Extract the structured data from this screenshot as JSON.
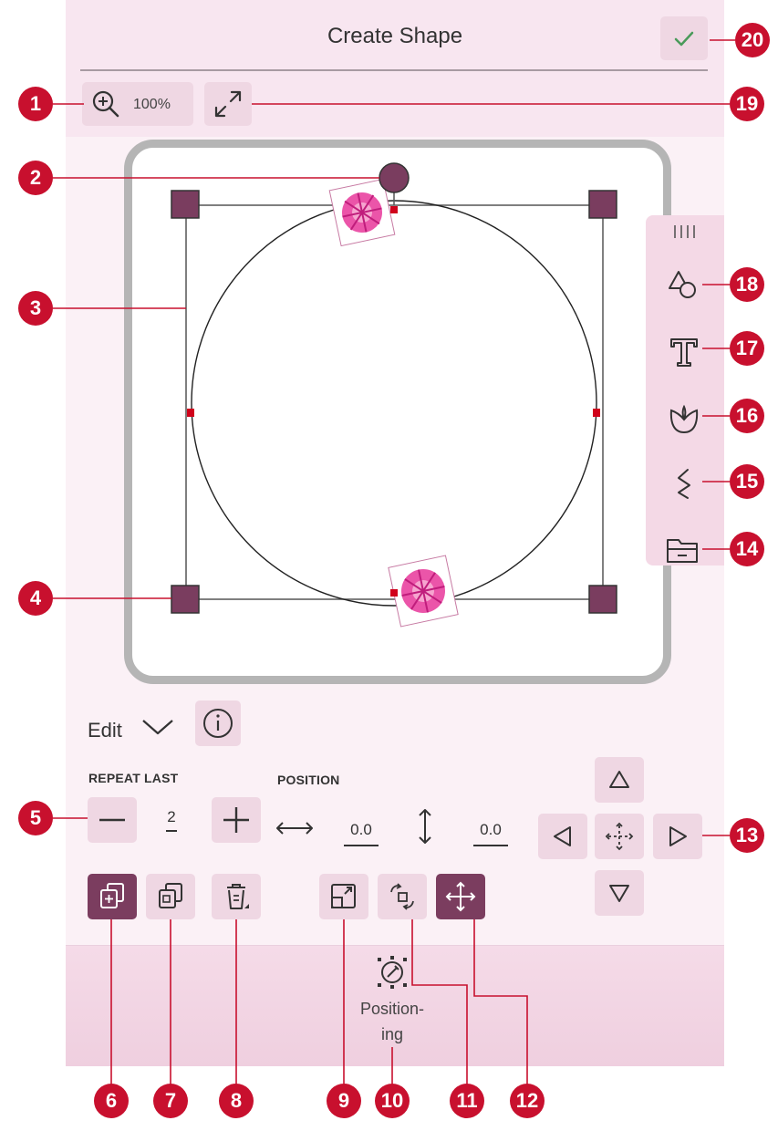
{
  "header": {
    "title": "Create Shape",
    "zoom_label": "100%"
  },
  "edit": {
    "label": "Edit"
  },
  "repeat_last": {
    "label": "REPEAT LAST",
    "value": "2"
  },
  "position": {
    "label": "POSITION",
    "x_value": "0.0",
    "y_value": "0.0"
  },
  "bottom_bar": {
    "label_line1": "Position-",
    "label_line2": "ing"
  },
  "callouts": {
    "c1": "1",
    "c2": "2",
    "c3": "3",
    "c4": "4",
    "c5": "5",
    "c6": "6",
    "c7": "7",
    "c8": "8",
    "c9": "9",
    "c10": "10",
    "c11": "11",
    "c12": "12",
    "c13": "13",
    "c14": "14",
    "c15": "15",
    "c16": "16",
    "c17": "17",
    "c18": "18",
    "c19": "19",
    "c20": "20"
  },
  "colors": {
    "accent_dark": "#7b3d5f",
    "button_light": "#efd7e3",
    "callout_red": "#c8102e",
    "design_pink": "#e8379a"
  },
  "icons": [
    "zoom-in-icon",
    "fullscreen-icon",
    "confirm-check-icon",
    "rotate-handle-icon",
    "shapes-icon",
    "text-icon",
    "design-icon",
    "stitch-icon",
    "folder-icon",
    "info-icon",
    "chevron-down-icon",
    "minus-icon",
    "plus-icon",
    "horizontal-arrow-icon",
    "vertical-arrow-icon",
    "duplicate-icon",
    "duplicate-alt-icon",
    "delete-icon",
    "scale-icon",
    "rotate-icon",
    "move-icon",
    "positioning-icon",
    "arrow-up-icon",
    "arrow-down-icon",
    "arrow-left-icon",
    "arrow-right-icon",
    "center-icon"
  ]
}
